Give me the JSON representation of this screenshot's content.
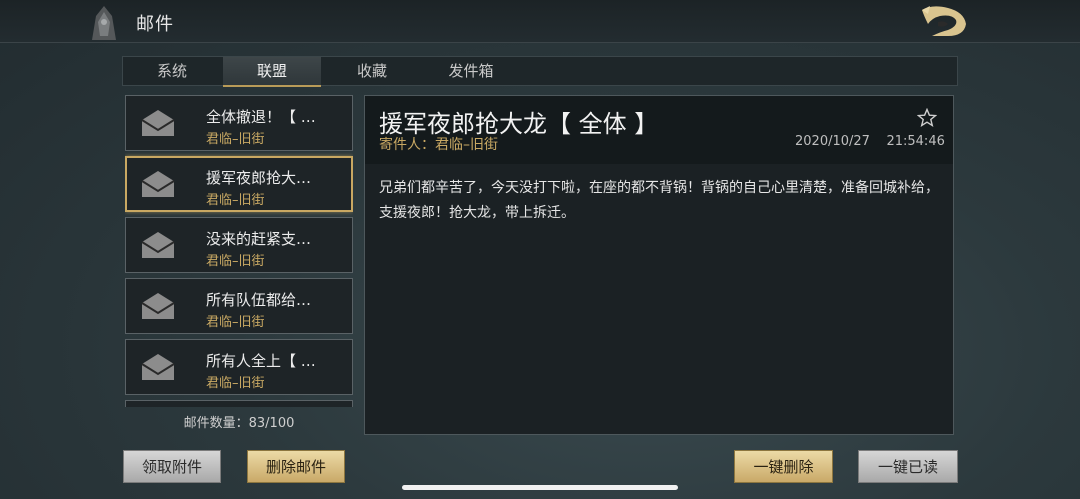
{
  "header": {
    "title": "邮件"
  },
  "tabs": [
    {
      "label": "系统",
      "active": false
    },
    {
      "label": "联盟",
      "active": true
    },
    {
      "label": "收藏",
      "active": false
    },
    {
      "label": "发件箱",
      "active": false
    }
  ],
  "mail_list": [
    {
      "subject": "全体撤退！【 …",
      "sender": "君临–旧街",
      "selected": false
    },
    {
      "subject": "援军夜郎抢大…",
      "sender": "君临–旧街",
      "selected": true
    },
    {
      "subject": "没来的赶紧支…",
      "sender": "君临–旧街",
      "selected": false
    },
    {
      "subject": "所有队伍都给…",
      "sender": "君临–旧街",
      "selected": false
    },
    {
      "subject": "所有人全上【 …",
      "sender": "君临–旧街",
      "selected": false
    }
  ],
  "mail_count": "邮件数量：83/100",
  "detail": {
    "title": "援军夜郎抢大龙【 全体 】",
    "sender_label": "寄件人：",
    "sender": "君临–旧街",
    "date": "2020/10/27",
    "time": "21:54:46",
    "body": "兄弟们都辛苦了，今天没打下啦，在座的都不背锅！背锅的自己心里清楚，准备回城补给，支援夜郎！抢大龙，带上拆迁。"
  },
  "buttons": {
    "claim_attachments": "领取附件",
    "delete_mail": "删除邮件",
    "delete_all": "一键删除",
    "mark_all_read": "一键已读"
  },
  "colors": {
    "accent_gold": "#c8a863",
    "selected_border": "#c9a862"
  }
}
